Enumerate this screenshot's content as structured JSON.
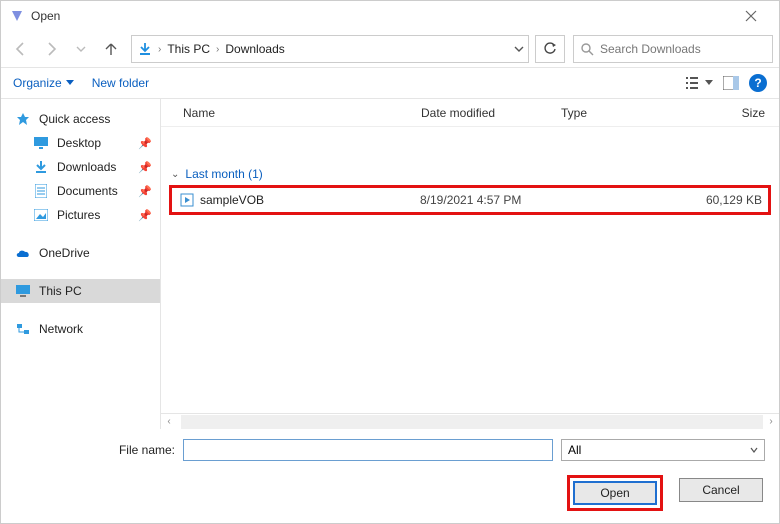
{
  "window": {
    "title": "Open"
  },
  "breadcrumb": {
    "root": "This PC",
    "folder": "Downloads"
  },
  "search": {
    "placeholder": "Search Downloads"
  },
  "toolbar": {
    "organize": "Organize",
    "newfolder": "New folder"
  },
  "headers": {
    "name": "Name",
    "date": "Date modified",
    "type": "Type",
    "size": "Size"
  },
  "tree": {
    "quick": "Quick access",
    "desktop": "Desktop",
    "downloads": "Downloads",
    "documents": "Documents",
    "pictures": "Pictures",
    "onedrive": "OneDrive",
    "thispc": "This PC",
    "network": "Network"
  },
  "group": {
    "label": "Last month (1)"
  },
  "file": {
    "name": "sampleVOB",
    "date": "8/19/2021 4:57 PM",
    "size": "60,129 KB"
  },
  "footer": {
    "filelabel": "File name:",
    "filter": "All",
    "open": "Open",
    "cancel": "Cancel"
  }
}
